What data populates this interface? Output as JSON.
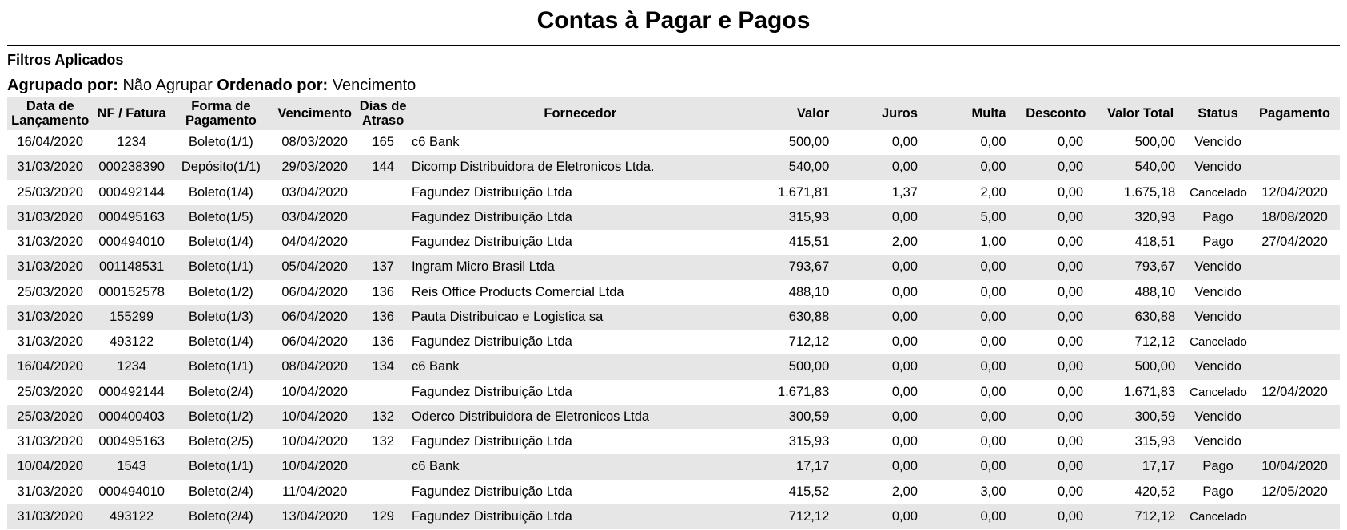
{
  "report": {
    "title": "Contas à Pagar e Pagos",
    "filters_heading": "Filtros Aplicados",
    "grouped_label": "Agrupado por:",
    "grouped_value": "Não Agrupar",
    "ordered_label": "Ordenado por:",
    "ordered_value": "Vencimento"
  },
  "table": {
    "headers": {
      "launch_line1": "Data de",
      "launch_line2": "Lançamento",
      "invoice": "NF / Fatura",
      "payment_form_line1": "Forma de",
      "payment_form_line2": "Pagamento",
      "due": "Vencimento",
      "late_line1": "Dias de",
      "late_line2": "Atraso",
      "supplier": "Fornecedor",
      "value": "Valor",
      "interest": "Juros",
      "fine": "Multa",
      "discount": "Desconto",
      "total": "Valor Total",
      "status": "Status",
      "payment": "Pagamento"
    },
    "rows": [
      {
        "launch": "16/04/2020",
        "invoice": "1234",
        "form": "Boleto(1/1)",
        "due": "08/03/2020",
        "late": "165",
        "supplier": "c6 Bank",
        "value": "500,00",
        "interest": "0,00",
        "fine": "0,00",
        "discount": "0,00",
        "total": "500,00",
        "status": "Vencido",
        "payment": ""
      },
      {
        "launch": "31/03/2020",
        "invoice": "000238390",
        "form": "Depósito(1/1)",
        "due": "29/03/2020",
        "late": "144",
        "supplier": "Dicomp Distribuidora de Eletronicos Ltda.",
        "value": "540,00",
        "interest": "0,00",
        "fine": "0,00",
        "discount": "0,00",
        "total": "540,00",
        "status": "Vencido",
        "payment": ""
      },
      {
        "launch": "25/03/2020",
        "invoice": "000492144",
        "form": "Boleto(1/4)",
        "due": "03/04/2020",
        "late": "",
        "supplier": "Fagundez Distribuição Ltda",
        "value": "1.671,81",
        "interest": "1,37",
        "fine": "2,00",
        "discount": "0,00",
        "total": "1.675,18",
        "status": "Cancelado",
        "payment": "12/04/2020"
      },
      {
        "launch": "31/03/2020",
        "invoice": "000495163",
        "form": "Boleto(1/5)",
        "due": "03/04/2020",
        "late": "",
        "supplier": "Fagundez Distribuição Ltda",
        "value": "315,93",
        "interest": "0,00",
        "fine": "5,00",
        "discount": "0,00",
        "total": "320,93",
        "status": "Pago",
        "payment": "18/08/2020"
      },
      {
        "launch": "31/03/2020",
        "invoice": "000494010",
        "form": "Boleto(1/4)",
        "due": "04/04/2020",
        "late": "",
        "supplier": "Fagundez Distribuição Ltda",
        "value": "415,51",
        "interest": "2,00",
        "fine": "1,00",
        "discount": "0,00",
        "total": "418,51",
        "status": "Pago",
        "payment": "27/04/2020"
      },
      {
        "launch": "31/03/2020",
        "invoice": "001148531",
        "form": "Boleto(1/1)",
        "due": "05/04/2020",
        "late": "137",
        "supplier": "Ingram Micro Brasil Ltda",
        "value": "793,67",
        "interest": "0,00",
        "fine": "0,00",
        "discount": "0,00",
        "total": "793,67",
        "status": "Vencido",
        "payment": ""
      },
      {
        "launch": "25/03/2020",
        "invoice": "000152578",
        "form": "Boleto(1/2)",
        "due": "06/04/2020",
        "late": "136",
        "supplier": "Reis Office Products Comercial Ltda",
        "value": "488,10",
        "interest": "0,00",
        "fine": "0,00",
        "discount": "0,00",
        "total": "488,10",
        "status": "Vencido",
        "payment": ""
      },
      {
        "launch": "31/03/2020",
        "invoice": "155299",
        "form": "Boleto(1/3)",
        "due": "06/04/2020",
        "late": "136",
        "supplier": "Pauta Distribuicao e Logistica sa",
        "value": "630,88",
        "interest": "0,00",
        "fine": "0,00",
        "discount": "0,00",
        "total": "630,88",
        "status": "Vencido",
        "payment": ""
      },
      {
        "launch": "31/03/2020",
        "invoice": "493122",
        "form": "Boleto(1/4)",
        "due": "06/04/2020",
        "late": "136",
        "supplier": "Fagundez Distribuição Ltda",
        "value": "712,12",
        "interest": "0,00",
        "fine": "0,00",
        "discount": "0,00",
        "total": "712,12",
        "status": "Cancelado",
        "payment": ""
      },
      {
        "launch": "16/04/2020",
        "invoice": "1234",
        "form": "Boleto(1/1)",
        "due": "08/04/2020",
        "late": "134",
        "supplier": "c6 Bank",
        "value": "500,00",
        "interest": "0,00",
        "fine": "0,00",
        "discount": "0,00",
        "total": "500,00",
        "status": "Vencido",
        "payment": ""
      },
      {
        "launch": "25/03/2020",
        "invoice": "000492144",
        "form": "Boleto(2/4)",
        "due": "10/04/2020",
        "late": "",
        "supplier": "Fagundez Distribuição Ltda",
        "value": "1.671,83",
        "interest": "0,00",
        "fine": "0,00",
        "discount": "0,00",
        "total": "1.671,83",
        "status": "Cancelado",
        "payment": "12/04/2020"
      },
      {
        "launch": "25/03/2020",
        "invoice": "000400403",
        "form": "Boleto(1/2)",
        "due": "10/04/2020",
        "late": "132",
        "supplier": "Oderco Distribuidora de Eletronicos Ltda",
        "value": "300,59",
        "interest": "0,00",
        "fine": "0,00",
        "discount": "0,00",
        "total": "300,59",
        "status": "Vencido",
        "payment": ""
      },
      {
        "launch": "31/03/2020",
        "invoice": "000495163",
        "form": "Boleto(2/5)",
        "due": "10/04/2020",
        "late": "132",
        "supplier": "Fagundez Distribuição Ltda",
        "value": "315,93",
        "interest": "0,00",
        "fine": "0,00",
        "discount": "0,00",
        "total": "315,93",
        "status": "Vencido",
        "payment": ""
      },
      {
        "launch": "10/04/2020",
        "invoice": "1543",
        "form": "Boleto(1/1)",
        "due": "10/04/2020",
        "late": "",
        "supplier": "c6 Bank",
        "value": "17,17",
        "interest": "0,00",
        "fine": "0,00",
        "discount": "0,00",
        "total": "17,17",
        "status": "Pago",
        "payment": "10/04/2020"
      },
      {
        "launch": "31/03/2020",
        "invoice": "000494010",
        "form": "Boleto(2/4)",
        "due": "11/04/2020",
        "late": "",
        "supplier": "Fagundez Distribuição Ltda",
        "value": "415,52",
        "interest": "2,00",
        "fine": "3,00",
        "discount": "0,00",
        "total": "420,52",
        "status": "Pago",
        "payment": "12/05/2020"
      },
      {
        "launch": "31/03/2020",
        "invoice": "493122",
        "form": "Boleto(2/4)",
        "due": "13/04/2020",
        "late": "129",
        "supplier": "Fagundez Distribuição Ltda",
        "value": "712,12",
        "interest": "0,00",
        "fine": "0,00",
        "discount": "0,00",
        "total": "712,12",
        "status": "Cancelado",
        "payment": ""
      }
    ]
  }
}
